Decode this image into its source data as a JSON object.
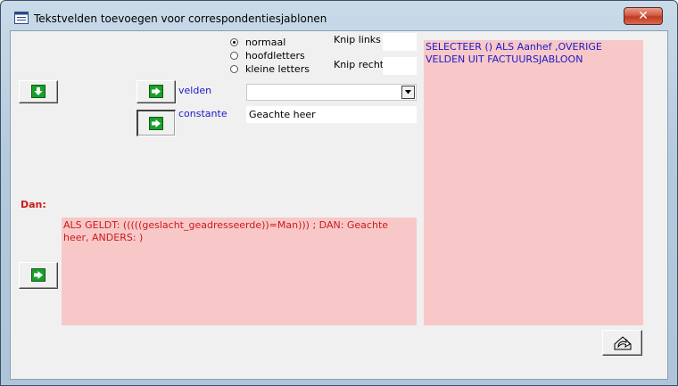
{
  "window": {
    "title": "Tekstvelden toevoegen voor correspondentiesjablonen",
    "close_label": "✕"
  },
  "radios": {
    "options": [
      "normaal",
      "hoofdletters",
      "kleine letters"
    ],
    "selected": "normaal"
  },
  "knip": {
    "links_label": "Knip links",
    "rechts_label": "Knip rechts",
    "links_value": "",
    "rechts_value": ""
  },
  "velden": {
    "label": "velden",
    "value": ""
  },
  "constante": {
    "label": "constante",
    "value": "Geachte heer"
  },
  "dan_label": "Dan:",
  "condition_text": "ALS GELDT: (((((geslacht_geadresseerde))=Man))) ; DAN:  Geachte heer, ANDERS: )",
  "select_text": "SELECTEER () ALS Aanhef ,OVERIGE VELDEN UIT FACTUURSJABLOON",
  "colors": {
    "pink": "#f8c8c8",
    "blue_text": "#1a1acc",
    "red_text": "#cc1a1a",
    "green_icon": "#1aa02a"
  },
  "icons": [
    "form-icon",
    "close-icon",
    "arrow-down-icon",
    "arrow-right-icon",
    "dropdown-arrow-icon",
    "undo-icon"
  ]
}
